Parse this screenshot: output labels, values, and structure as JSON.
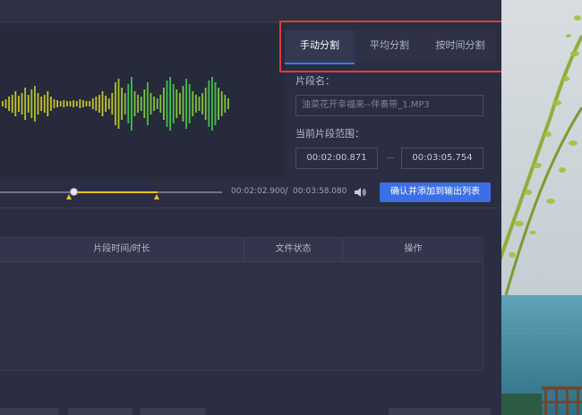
{
  "tabs": [
    {
      "label": "手动分割",
      "active": true
    },
    {
      "label": "平均分割",
      "active": false
    },
    {
      "label": "按时间分割",
      "active": false
    }
  ],
  "segment": {
    "name_label": "片段名：",
    "name_value": "油菜花开幸福来--伴奏带_1.MP3",
    "range_label": "当前片段范围：",
    "start_time": "00:02:00.871",
    "end_time": "00:03:05.754"
  },
  "player": {
    "current_time": "00:02:02.900",
    "separator": "/",
    "total_time": "00:03:58.080",
    "confirm_label": "确认并添加到输出列表",
    "progress_fraction": 0.333,
    "selection_start_fraction": 0.322,
    "selection_end_fraction": 0.706
  },
  "table": {
    "columns": [
      "片段时间/时长",
      "文件状态",
      "操作"
    ]
  },
  "colors": {
    "accent": "#3b6fe6",
    "highlight_box": "#e23b3b",
    "selection": "#f0c419"
  }
}
